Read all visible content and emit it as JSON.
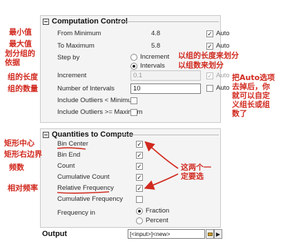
{
  "computation": {
    "title": "Computation Control",
    "from_minimum": {
      "label": "From Minimum",
      "value": "4.8",
      "auto_label": "Auto",
      "auto_checked": true
    },
    "to_maximum": {
      "label": "To Maximum",
      "value": "5.8",
      "auto_label": "Auto",
      "auto_checked": true
    },
    "step_by": {
      "label": "Step by",
      "options": [
        "Increment",
        "Intervals"
      ],
      "selected": "Intervals"
    },
    "increment": {
      "label": "Increment",
      "value": "0.1",
      "auto_label": "Auto",
      "auto_checked": true,
      "enabled": false
    },
    "intervals": {
      "label": "Number of Intervals",
      "value": "10",
      "auto_label": "Auto",
      "auto_checked": false
    },
    "outliers_min": {
      "label": "Include Outliers < Minimum",
      "checked": false
    },
    "outliers_max": {
      "label": "Include Outliers >= Maximum",
      "checked": false
    }
  },
  "quantities": {
    "title": "Quantities to Compute",
    "items": [
      {
        "label": "Bin Center",
        "checked": true,
        "underlined": true
      },
      {
        "label": "Bin End",
        "checked": true,
        "underlined": false
      },
      {
        "label": "Count",
        "checked": true,
        "underlined": false
      },
      {
        "label": "Cumulative Count",
        "checked": true,
        "underlined": false
      },
      {
        "label": "Relative Frequency",
        "checked": true,
        "underlined": true
      },
      {
        "label": "Cumulative Frequency",
        "checked": false,
        "underlined": false
      }
    ],
    "frequency_in": {
      "label": "Frequency in",
      "options": [
        "Fraction",
        "Percent"
      ],
      "selected": "Fraction"
    }
  },
  "output": {
    "label": "Output",
    "value": "[<input>]<new>"
  },
  "annotations": {
    "min": "最小值",
    "max": "最大值",
    "groups": "划分组的\n依据",
    "group_length": "组的长度",
    "group_count": "组的数量",
    "by_length": "以组的长度来划分",
    "by_count": "以组数来划分",
    "remove_auto": "把Auto选项\n去掉后，你\n就可以自定\n义组长或组\n数了",
    "bin_center": "矩形中心",
    "bin_end": "矩形右边界",
    "count": "频数",
    "rel_freq": "相对频率",
    "must_select": "这两个一\n定要选"
  },
  "colors": {
    "annotation": "#d12a1f",
    "panel_bg": "#f4f4f4"
  }
}
